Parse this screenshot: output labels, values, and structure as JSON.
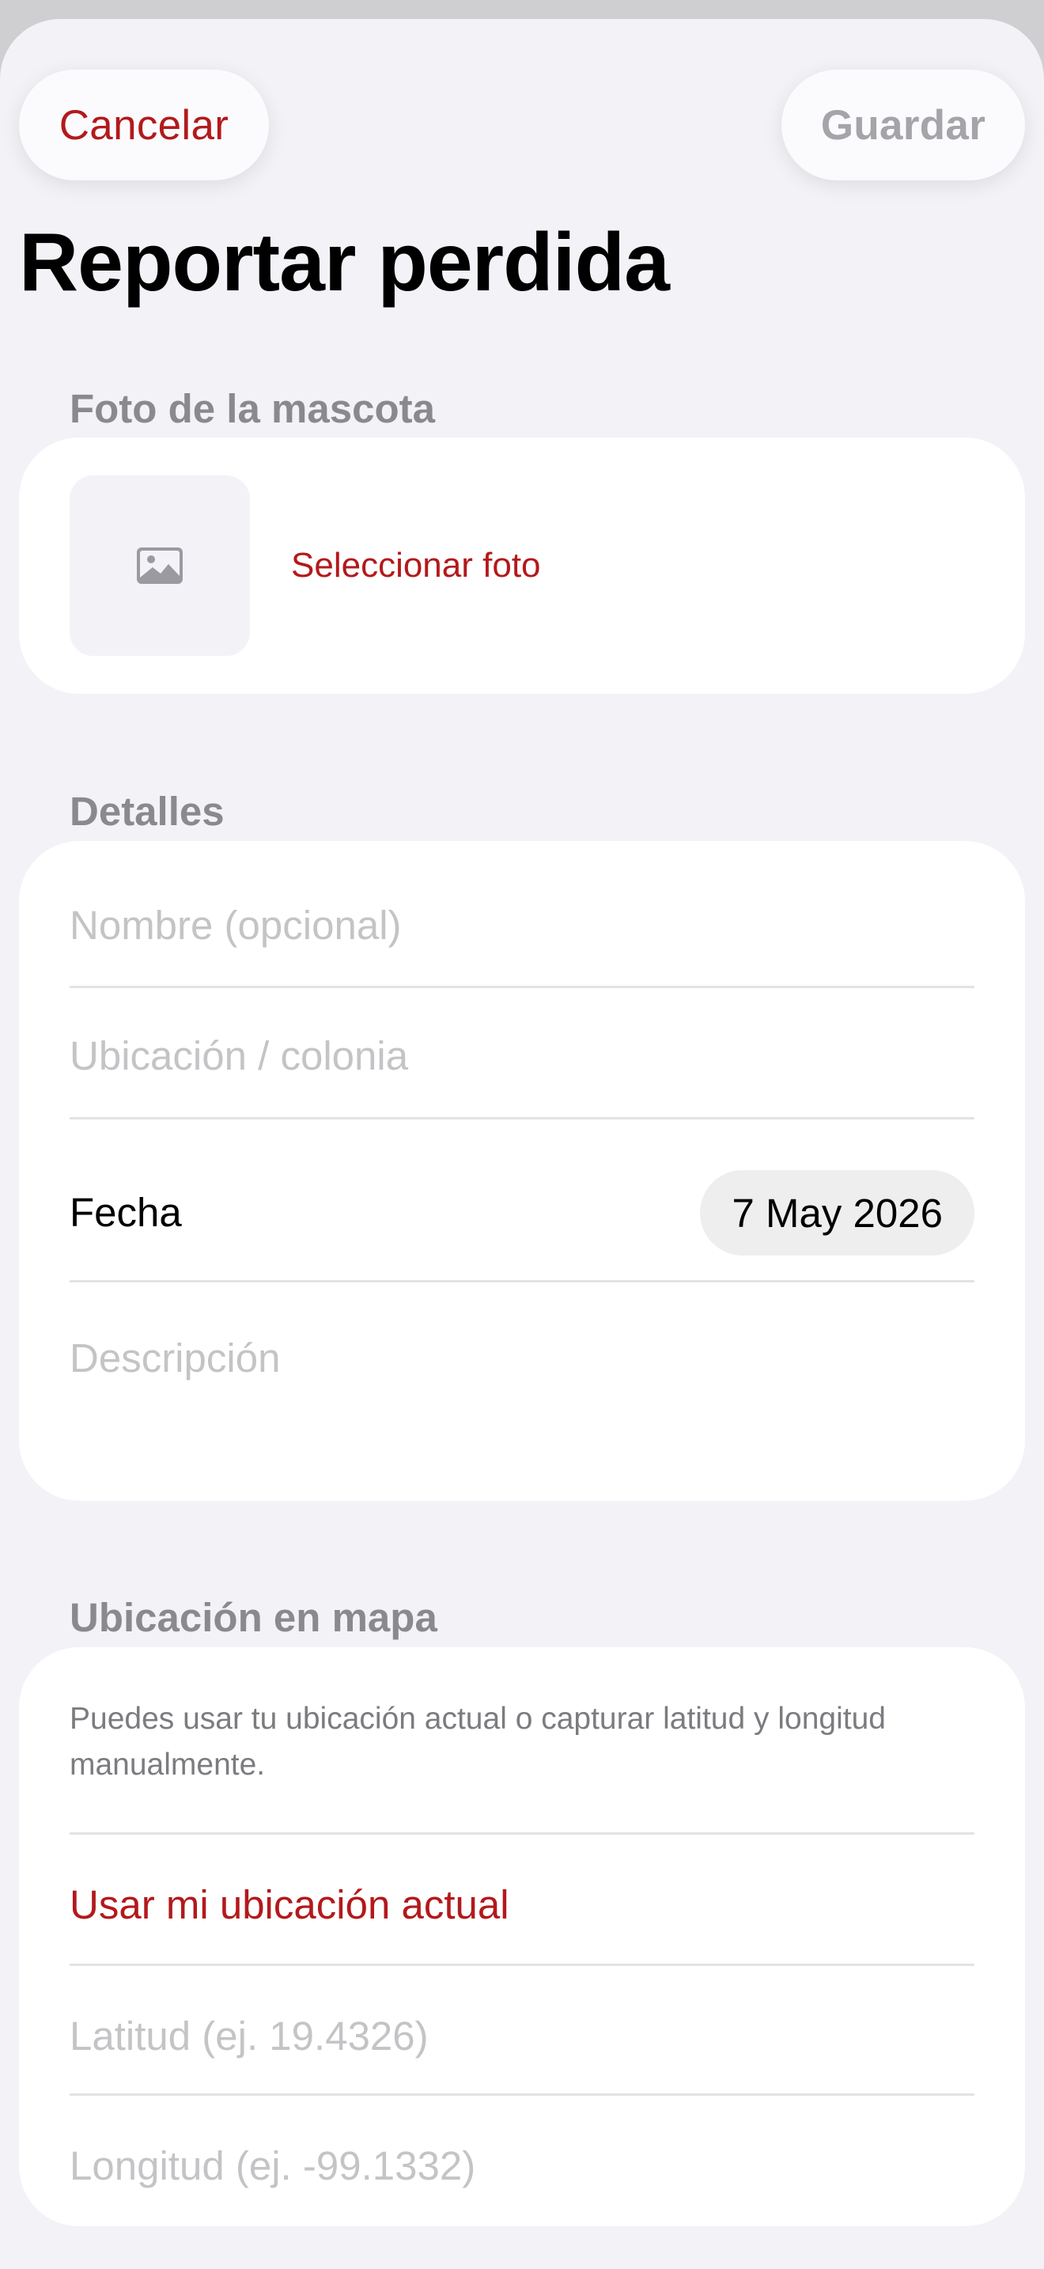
{
  "header": {
    "cancel_label": "Cancelar",
    "save_label": "Guardar",
    "title": "Reportar perdida"
  },
  "photo_section": {
    "header": "Foto de la mascota",
    "thumbnail_icon": "photo-icon",
    "select_label": "Seleccionar foto"
  },
  "details_section": {
    "header": "Detalles",
    "name_placeholder": "Nombre (opcional)",
    "location_placeholder": "Ubicación / colonia",
    "date_label": "Fecha",
    "date_value": "7 May 2026",
    "description_placeholder": "Descripción"
  },
  "map_section": {
    "header": "Ubicación en mapa",
    "hint": "Puedes usar tu ubicación actual o capturar latitud y longitud manualmente.",
    "use_location_label": "Usar mi ubicación actual",
    "latitude_placeholder": "Latitud (ej. 19.4326)",
    "longitude_placeholder": "Longitud (ej. -99.1332)"
  },
  "colors": {
    "accent": "#b3191c",
    "background": "#f2f2f7",
    "card": "#ffffff",
    "section_header": "#8a8a8e",
    "placeholder": "#c4c4c7"
  }
}
